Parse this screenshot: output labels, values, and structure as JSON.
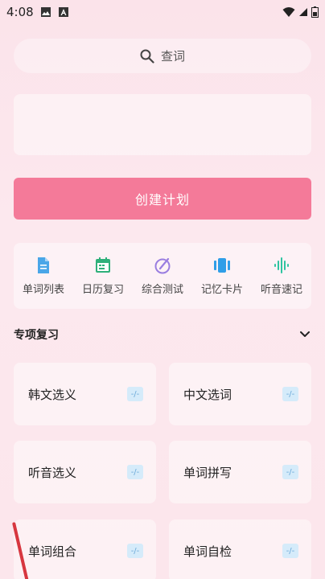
{
  "status": {
    "time": "4:08"
  },
  "search": {
    "label": "查词"
  },
  "create_plan": {
    "label": "创建计划"
  },
  "quick_actions": [
    {
      "label": "单词列表",
      "icon": "document-icon",
      "color": "#4aa6e8"
    },
    {
      "label": "日历复习",
      "icon": "calendar-icon",
      "color": "#2fb07a"
    },
    {
      "label": "综合测试",
      "icon": "test-icon",
      "color": "#9a7ee0"
    },
    {
      "label": "记忆卡片",
      "icon": "cards-icon",
      "color": "#2f9ee8"
    },
    {
      "label": "听音速记",
      "icon": "audio-wave-icon",
      "color": "#2fc4a0"
    }
  ],
  "review": {
    "title": "专项复习",
    "items": [
      {
        "label": "韩文选义",
        "badge": "-/-"
      },
      {
        "label": "中文选词",
        "badge": "-/-"
      },
      {
        "label": "听音选义",
        "badge": "-/-"
      },
      {
        "label": "单词拼写",
        "badge": "-/-"
      },
      {
        "label": "单词组合",
        "badge": "-/-"
      },
      {
        "label": "单词自检",
        "badge": "-/-"
      }
    ]
  },
  "colors": {
    "accent": "#f47a99",
    "badge_bg": "#d5ebfa",
    "badge_text": "#6aa8d8"
  }
}
